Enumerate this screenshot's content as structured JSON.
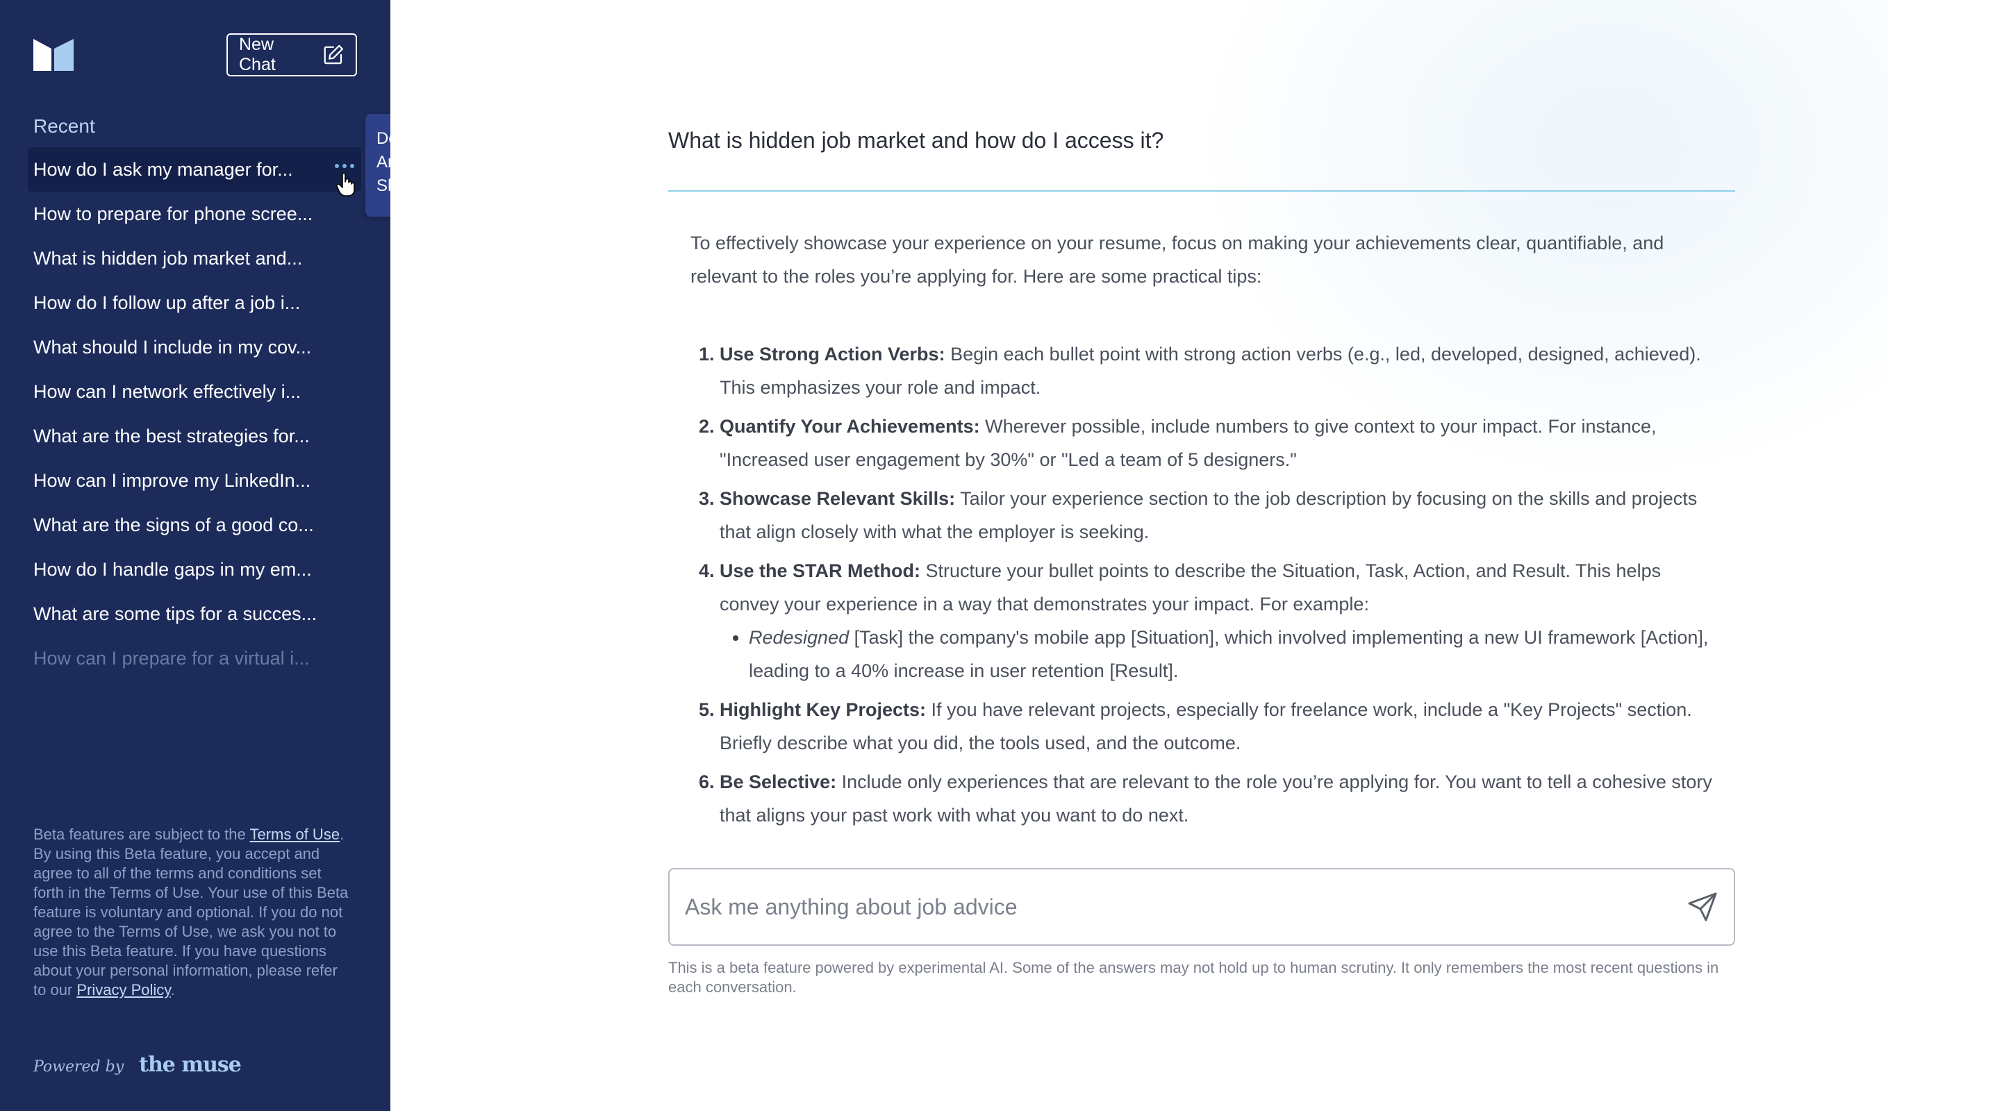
{
  "sidebar": {
    "new_chat_label": "New Chat",
    "recent_label": "Recent",
    "history": [
      "How do I ask my manager for...",
      "How to prepare for phone scree...",
      "What is hidden job market and...",
      "How do I follow up after a job i...",
      "What should I include in my cov...",
      "How can I network effectively i...",
      "What are the best strategies for...",
      "How can I improve my LinkedIn...",
      "What are the signs of a good co...",
      "How do I handle gaps in my em...",
      "What are some tips for a succes...",
      "How can I prepare for a virtual i..."
    ],
    "context_menu": [
      "Delete",
      "Archive",
      "Share"
    ],
    "disclaimer": {
      "pre": "Beta features are subject to the ",
      "terms_link": "Terms of Use",
      "mid": ". By using this Beta feature, you accept and agree to all of the terms and conditions set forth in the Terms of Use. Your use of this Beta feature is voluntary and optional. If you do not agree to the Terms of Use, we ask you not to use this Beta feature. If you have questions about your personal information, please refer to our ",
      "privacy_link": "Privacy Policy",
      "post": "."
    },
    "powered_by": "Powered by",
    "brand": "the muse",
    "colors": {
      "background": "#1c2b5a",
      "active_item": "#13204a",
      "menu": "#2d4088"
    }
  },
  "main": {
    "question": "What is hidden job market and how do I access it?",
    "answer_intro": "To effectively showcase your experience on your resume, focus on making your achievements clear, quantifiable, and relevant to the roles you’re applying for. Here are some practical tips:",
    "tips": [
      {
        "title": "Use Strong Action Verbs:",
        "text": " Begin each bullet point with strong action verbs (e.g., led, developed, designed, achieved). This emphasizes your role and impact."
      },
      {
        "title": "Quantify Your Achievements:",
        "text": " Wherever possible, include numbers to give context to your impact. For instance, \"Increased user engagement by 30%\" or \"Led a team of 5 designers.\""
      },
      {
        "title": "Showcase Relevant Skills:",
        "text": " Tailor your experience section to the job description by focusing on the skills and projects that align closely with what the employer is seeking."
      },
      {
        "title": "Use the STAR Method:",
        "text": " Structure your bullet points to describe the Situation, Task, Action, and Result. This helps convey your experience in a way that demonstrates your impact. For example:"
      },
      {
        "title": "Highlight Key Projects:",
        "text": " If you have relevant projects, especially for freelance work, include a \"Key Projects\" section. Briefly describe what you did, the tools used, and the outcome."
      },
      {
        "title": "Be Selective:",
        "text": " Include only experiences that are relevant to the role you’re applying for. You want to tell a cohesive story that aligns your past work with what you want to do next."
      }
    ],
    "star_example": {
      "italic": "Redesigned",
      "text": " [Task] the company's mobile app [Situation], which involved implementing a new UI framework [Action], leading to a 40% increase in user retention [Result]."
    },
    "ask_placeholder": "Ask me anything about job advice",
    "beta_note": "This is a beta feature powered by experimental AI. Some of the answers may not hold up to human scrutiny. It only remembers the most recent questions in each conversation."
  }
}
